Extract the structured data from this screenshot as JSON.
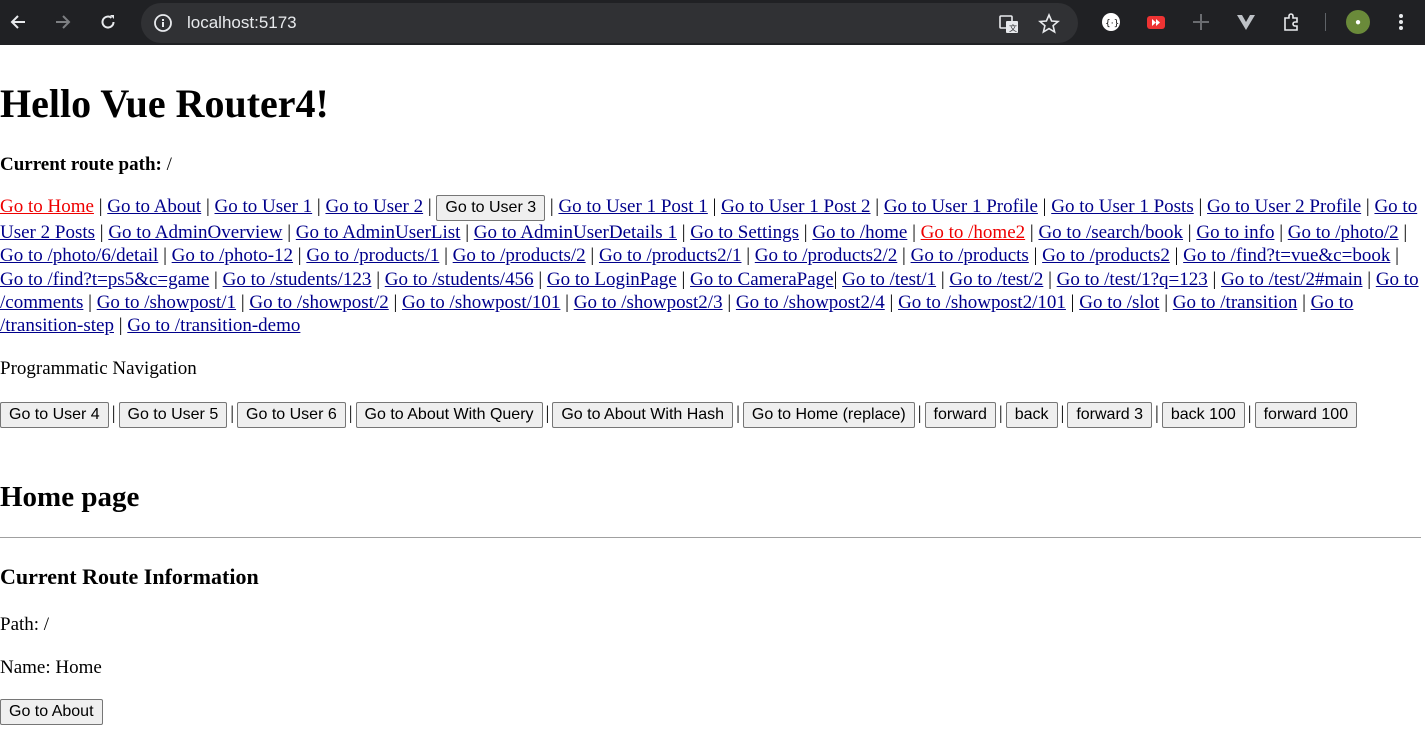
{
  "browser": {
    "url": "localhost:5173"
  },
  "page": {
    "title": "Hello Vue Router4!",
    "current_route_label": "Current route path:",
    "current_route_value": " /",
    "links": [
      {
        "type": "link",
        "label": "Go to Home",
        "active": true
      },
      {
        "type": "link",
        "label": "Go to About"
      },
      {
        "type": "link",
        "label": "Go to User 1"
      },
      {
        "type": "link",
        "label": "Go to User 2"
      },
      {
        "type": "button",
        "label": "Go to User 3"
      },
      {
        "type": "link",
        "label": "Go to User 1 Post 1"
      },
      {
        "type": "link",
        "label": "Go to User 1 Post 2"
      },
      {
        "type": "link",
        "label": "Go to User 1 Profile"
      },
      {
        "type": "link",
        "label": "Go to User 1 Posts"
      },
      {
        "type": "link",
        "label": "Go to User 2 Profile"
      },
      {
        "type": "link",
        "label": "Go to User 2 Posts"
      },
      {
        "type": "link",
        "label": "Go to AdminOverview"
      },
      {
        "type": "link",
        "label": "Go to AdminUserList"
      },
      {
        "type": "link",
        "label": "Go to AdminUserDetails 1"
      },
      {
        "type": "link",
        "label": "Go to Settings"
      },
      {
        "type": "link",
        "label": "Go to /home"
      },
      {
        "type": "link",
        "label": "Go to /home2",
        "active": true
      },
      {
        "type": "link",
        "label": "Go to /search/book"
      },
      {
        "type": "link",
        "label": "Go to info"
      },
      {
        "type": "link",
        "label": "Go to /photo/2"
      },
      {
        "type": "link",
        "label": "Go to /photo/6/detail"
      },
      {
        "type": "link",
        "label": "Go to /photo-12"
      },
      {
        "type": "link",
        "label": "Go to /products/1"
      },
      {
        "type": "link",
        "label": "Go to /products/2"
      },
      {
        "type": "link",
        "label": "Go to /products2/1"
      },
      {
        "type": "link",
        "label": "Go to /products2/2"
      },
      {
        "type": "link",
        "label": "Go to /products"
      },
      {
        "type": "link",
        "label": "Go to /products2"
      },
      {
        "type": "link",
        "label": "Go to /find?t=vue&c=book"
      },
      {
        "type": "link",
        "label": "Go to /find?t=ps5&c=game"
      },
      {
        "type": "link",
        "label": "Go to /students/123"
      },
      {
        "type": "link",
        "label": "Go to /students/456"
      },
      {
        "type": "link",
        "label": "Go to LoginPage"
      },
      {
        "type": "link",
        "label": "Go to CameraPage",
        "nospace": true
      },
      {
        "type": "link",
        "label": "Go to /test/1"
      },
      {
        "type": "link",
        "label": "Go to /test/2"
      },
      {
        "type": "link",
        "label": "Go to /test/1?q=123"
      },
      {
        "type": "link",
        "label": "Go to /test/2#main"
      },
      {
        "type": "link",
        "label": "Go to /comments"
      },
      {
        "type": "link",
        "label": "Go to /showpost/1"
      },
      {
        "type": "link",
        "label": "Go to /showpost/2"
      },
      {
        "type": "link",
        "label": "Go to /showpost/101"
      },
      {
        "type": "link",
        "label": "Go to /showpost2/3"
      },
      {
        "type": "link",
        "label": "Go to /showpost2/4"
      },
      {
        "type": "link",
        "label": "Go to /showpost2/101"
      },
      {
        "type": "link",
        "label": "Go to /slot"
      },
      {
        "type": "link",
        "label": "Go to /transition"
      },
      {
        "type": "link",
        "label": "Go to /transition-step"
      },
      {
        "type": "link",
        "label": "Go to /transition-demo"
      }
    ],
    "programmatic_title": "Programmatic Navigation",
    "programmatic_buttons": [
      "Go to User 4",
      "Go to User 5",
      "Go to User 6",
      "Go to About With Query",
      "Go to About With Hash",
      "Go to Home (replace)",
      "forward",
      "back",
      "forward 3",
      "back 100",
      "forward 100"
    ],
    "view_heading": "Home page",
    "route_info_heading": "Current Route Information",
    "path_line": "Path: /",
    "name_line": "Name: Home",
    "go_about_button": "Go to About"
  },
  "colors": {
    "link": "#00008b",
    "active_link": "#ee0000",
    "chrome_bg": "#202124",
    "omnibox_bg": "#303134"
  }
}
